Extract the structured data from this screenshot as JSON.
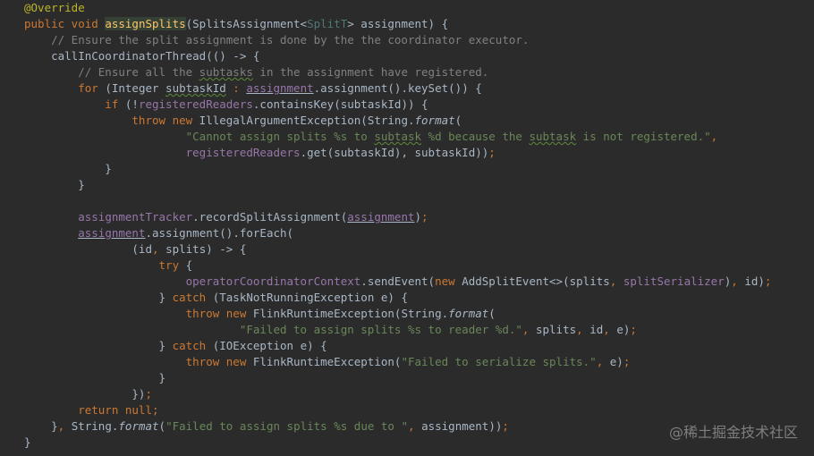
{
  "code": {
    "l01": {
      "p0": "@Override"
    },
    "l02": {
      "p0": "public void ",
      "p1": "assignSplits",
      "p2": "(SplitsAssignment<",
      "p3": "SplitT",
      "p4": "> assignment) {"
    },
    "l03": {
      "p0": "    // Ensure the split assignment is done by the the coordinator executor."
    },
    "l04": {
      "p0": "    callInCoordinatorThread(() -> {"
    },
    "l05": {
      "p0": "        // Ensure all the ",
      "p1": "subtasks",
      "p2": " in the assignment have registered."
    },
    "l06": {
      "p0": "        for ",
      "p1": "(Integer ",
      "p2": "subtaskId",
      "p3": " : ",
      "p4": "assignment",
      "p5": ".assignment().keySet()) {"
    },
    "l07": {
      "p0": "            if ",
      "p1": "(!",
      "p2": "registeredReaders",
      "p3": ".containsKey(subtaskId)) {"
    },
    "l08": {
      "p0": "                throw new ",
      "p1": "IllegalArgumentException(String.",
      "p2": "format",
      "p3": "("
    },
    "l09": {
      "p0": "                        \"Cannot assign splits %s to ",
      "p1": "subtask",
      "p2": " %d because the ",
      "p3": "subtask",
      "p4": " is not registered.\"",
      "p5": ","
    },
    "l10": {
      "p0": "                        ",
      "p1": "registeredReaders",
      "p2": ".get(subtaskId), subtaskId))",
      "p3": ";"
    },
    "l11": {
      "p0": "            }"
    },
    "l12": {
      "p0": "        }"
    },
    "l13": {
      "p0": ""
    },
    "l14": {
      "p0": "        ",
      "p1": "assignmentTracker",
      "p2": ".recordSplitAssignment(",
      "p3": "assignment",
      "p4": ")",
      "p5": ";"
    },
    "l15": {
      "p0": "        ",
      "p1": "assignment",
      "p2": ".assignment().forEach("
    },
    "l16": {
      "p0": "                (id",
      "p1": ", ",
      "p2": "splits) -> {"
    },
    "l17": {
      "p0": "                    try ",
      "p1": "{"
    },
    "l18": {
      "p0": "                        ",
      "p1": "operatorCoordinatorContext",
      "p2": ".sendEvent(",
      "p3": "new ",
      "p4": "AddSplitEvent<>(splits",
      "p5": ", ",
      "p6": "splitSerializer",
      "p7": ")",
      "p8": ", ",
      "p9": "id)",
      "p10": ";"
    },
    "l19": {
      "p0": "                    } ",
      "p1": "catch ",
      "p2": "(TaskNotRunningException e) {"
    },
    "l20": {
      "p0": "                        throw new ",
      "p1": "FlinkRuntimeException(String.",
      "p2": "format",
      "p3": "("
    },
    "l21": {
      "p0": "                                \"Failed to assign splits %s to reader %d.\"",
      "p1": ", ",
      "p2": "splits",
      "p3": ", ",
      "p4": "id",
      "p5": ", ",
      "p6": "e)",
      "p7": ";"
    },
    "l22": {
      "p0": "                    } ",
      "p1": "catch ",
      "p2": "(IOException e) {"
    },
    "l23": {
      "p0": "                        throw new ",
      "p1": "FlinkRuntimeException(",
      "p2": "\"Failed to serialize splits.\"",
      "p3": ", ",
      "p4": "e)",
      "p5": ";"
    },
    "l24": {
      "p0": "                    }"
    },
    "l25": {
      "p0": "                })",
      "p1": ";"
    },
    "l26": {
      "p0": "        return null;"
    },
    "l27": {
      "p0": "    }",
      "p1": ", ",
      "p2": "String.",
      "p3": "format",
      "p4": "(",
      "p5": "\"Failed to assign splits %s due to \"",
      "p6": ", ",
      "p7": "assignment))",
      "p8": ";"
    },
    "l28": {
      "p0": "}"
    }
  },
  "watermark": "@稀土掘金技术社区",
  "colors": {
    "background": "#2b2b2b",
    "text": "#a9b7c6",
    "keyword": "#cc7832",
    "annotation": "#bbb529",
    "comment": "#808080",
    "string": "#6a8759",
    "field": "#9876aa",
    "method_declaration": "#ffc66d"
  }
}
